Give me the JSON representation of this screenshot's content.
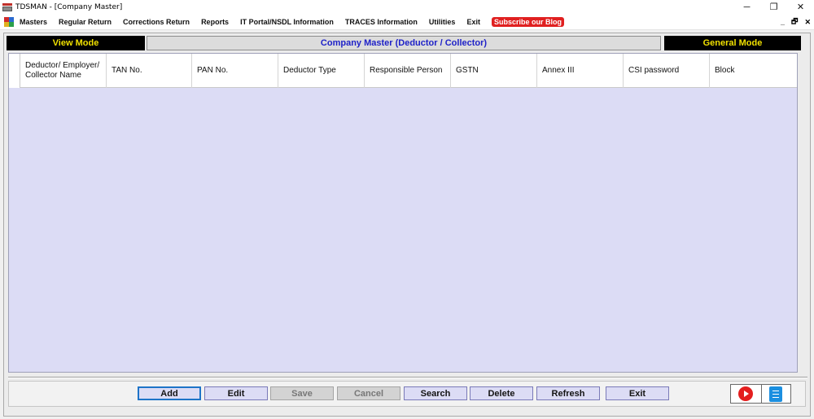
{
  "window": {
    "title": "TDSMAN - [Company Master]",
    "controls": [
      "─",
      "❐",
      "✕"
    ]
  },
  "menu": {
    "items": [
      "Masters",
      "Regular Return",
      "Corrections Return",
      "Reports",
      "IT Portal/NSDL Information",
      "TRACES Information",
      "Utilities",
      "Exit"
    ],
    "subscribe": "Subscribe our Blog",
    "mdi_controls": [
      "_",
      "🗗",
      "✕"
    ]
  },
  "modebar": {
    "left": "View Mode",
    "center": "Company Master (Deductor / Collector)",
    "right": "General Mode"
  },
  "grid": {
    "columns": [
      "Deductor/ Employer/ Collector Name",
      "TAN No.",
      "PAN No.",
      "Deductor Type",
      "Responsible Person",
      "GSTN",
      "Annex III",
      "CSI password",
      "Block"
    ],
    "rows": []
  },
  "toolbar": {
    "buttons": [
      {
        "label": "Add",
        "state": "focused"
      },
      {
        "label": "Edit",
        "state": "enabled"
      },
      {
        "label": "Save",
        "state": "disabled"
      },
      {
        "label": "Cancel",
        "state": "disabled"
      },
      {
        "label": "Search",
        "state": "enabled"
      },
      {
        "label": "Delete",
        "state": "enabled"
      },
      {
        "label": "Refresh",
        "state": "enabled"
      },
      {
        "label": "Exit",
        "state": "enabled"
      }
    ],
    "icons": [
      "youtube-play-icon",
      "document-icon"
    ]
  },
  "colors": {
    "mode_bar_bg": "#000000",
    "mode_bar_text": "#f0e000",
    "title_text": "#1f22c8",
    "grid_body": "#dcdcf5",
    "subscribe_bg": "#e02020"
  }
}
